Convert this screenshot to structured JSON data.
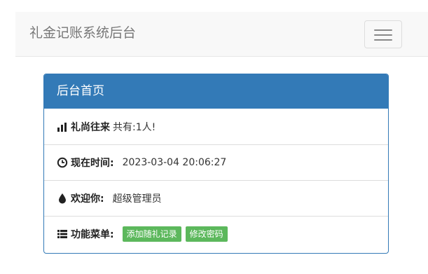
{
  "navbar": {
    "brand": "礼金记账系统后台",
    "toggle_icon": "hamburger-menu-icon"
  },
  "panel": {
    "title": "后台首页",
    "rows": {
      "stats": {
        "icon": "bar-chart-icon",
        "label": "礼尚往来",
        "value": "共有:1人!"
      },
      "time": {
        "icon": "clock-icon",
        "label": "现在时间:",
        "value": "2023-03-04 20:06:27"
      },
      "welcome": {
        "icon": "tint-icon",
        "label": "欢迎你:",
        "value": "超级管理员"
      },
      "menu": {
        "icon": "list-icon",
        "label": "功能菜单:",
        "buttons": [
          "添加随礼记录",
          "修改密码"
        ]
      }
    }
  },
  "colors": {
    "primary": "#337ab7",
    "success": "#5cb85c",
    "navbar_bg": "#f8f8f8"
  }
}
